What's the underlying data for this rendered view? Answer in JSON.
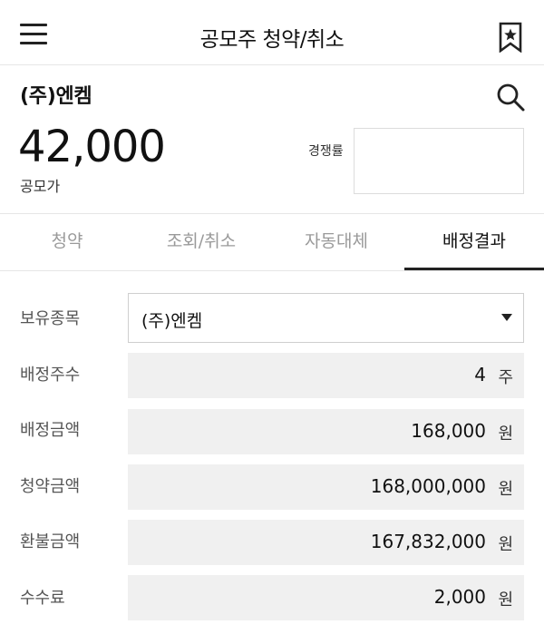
{
  "header": {
    "title": "공모주 청약/취소",
    "menu_icon": "hamburger-menu-icon",
    "bookmark_icon": "bookmark-star-icon"
  },
  "stock": {
    "name": "(주)엔켐",
    "search_icon": "search-icon",
    "price": "42,000",
    "price_label": "공모가",
    "competition_label": "경쟁률"
  },
  "tabs": [
    {
      "label": "청약",
      "active": false
    },
    {
      "label": "조회/취소",
      "active": false
    },
    {
      "label": "자동대체",
      "active": false
    },
    {
      "label": "배정결과",
      "active": true
    }
  ],
  "result": {
    "holding": {
      "label": "보유종목",
      "value": "(주)엔켐"
    },
    "rows": [
      {
        "label": "배정주수",
        "value": "4",
        "unit": "주"
      },
      {
        "label": "배정금액",
        "value": "168,000",
        "unit": "원"
      },
      {
        "label": "청약금액",
        "value": "168,000,000",
        "unit": "원"
      },
      {
        "label": "환불금액",
        "value": "167,832,000",
        "unit": "원"
      },
      {
        "label": "수수료",
        "value": "2,000",
        "unit": "원"
      }
    ]
  },
  "colors": {
    "active_tab": "#111111",
    "inactive_tab": "#9a9a9a",
    "value_box_bg": "#f0f0f0"
  }
}
